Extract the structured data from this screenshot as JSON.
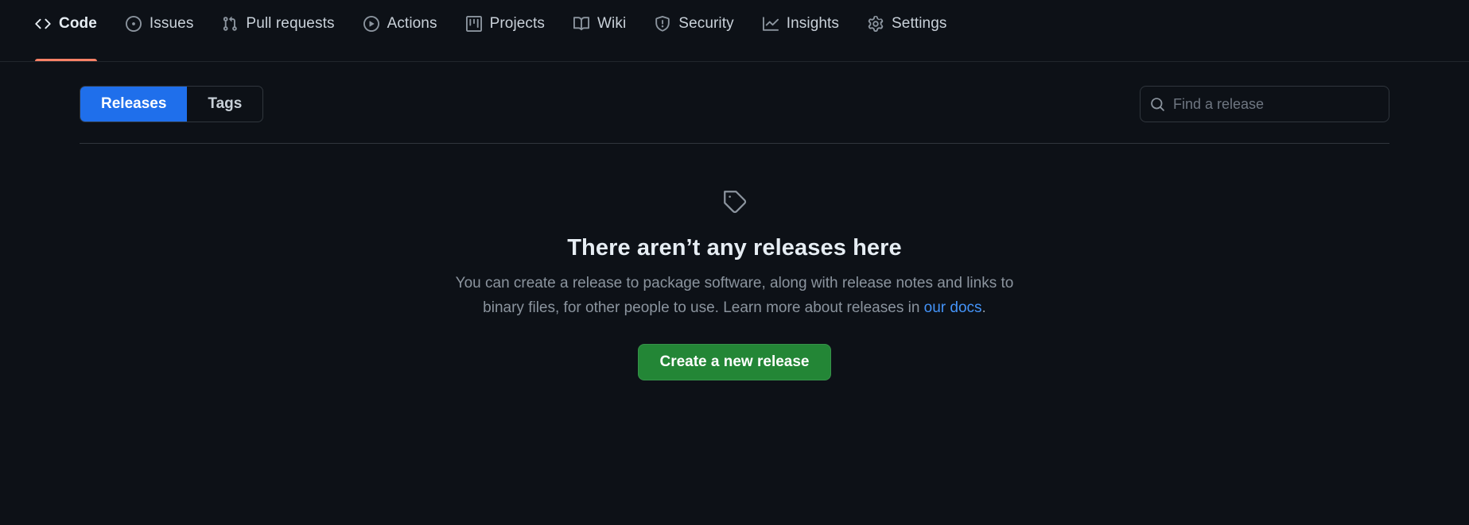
{
  "repo_nav": {
    "items": [
      {
        "label": "Code",
        "icon": "code-icon",
        "active": true
      },
      {
        "label": "Issues",
        "icon": "issue-opened-icon",
        "active": false
      },
      {
        "label": "Pull requests",
        "icon": "git-pull-request-icon",
        "active": false
      },
      {
        "label": "Actions",
        "icon": "play-icon",
        "active": false
      },
      {
        "label": "Projects",
        "icon": "project-icon",
        "active": false
      },
      {
        "label": "Wiki",
        "icon": "book-icon",
        "active": false
      },
      {
        "label": "Security",
        "icon": "shield-icon",
        "active": false
      },
      {
        "label": "Insights",
        "icon": "graph-icon",
        "active": false
      },
      {
        "label": "Settings",
        "icon": "gear-icon",
        "active": false
      }
    ],
    "active_underline_color": "#f78166"
  },
  "controls": {
    "segmented": {
      "releases_label": "Releases",
      "tags_label": "Tags",
      "selected": "Releases",
      "selected_color": "#1f6feb"
    },
    "search": {
      "icon": "search-icon",
      "placeholder": "Find a release",
      "value": ""
    }
  },
  "empty_state": {
    "icon": "tag-icon",
    "heading": "There aren’t any releases here",
    "body_part_1": "You can create a release to package software, along with release notes and links to binary files, for other people to use. Learn more about releases in ",
    "link_label": "our docs",
    "body_part_2": ".",
    "button_label": "Create a new release",
    "button_color": "#238636"
  },
  "theme": {
    "background": "#0d1117",
    "border": "#30363d",
    "text_primary": "#e6edf3",
    "text_muted": "#8b949e",
    "link": "#4493f8"
  }
}
